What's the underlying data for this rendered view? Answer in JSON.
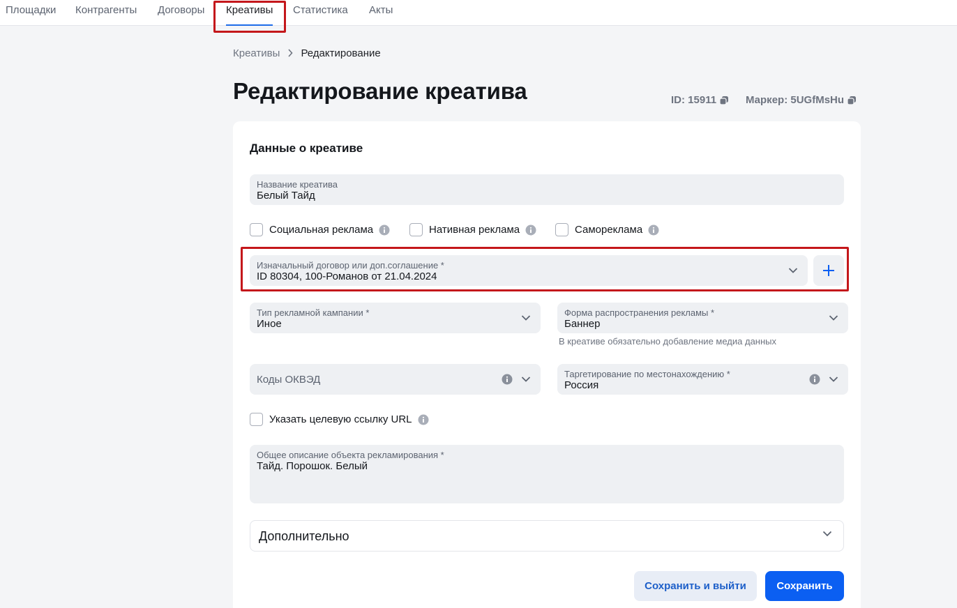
{
  "nav": {
    "tabs": [
      {
        "label": "Площадки"
      },
      {
        "label": "Контрагенты"
      },
      {
        "label": "Договоры"
      },
      {
        "label": "Креативы"
      },
      {
        "label": "Статистика"
      },
      {
        "label": "Акты"
      }
    ],
    "active": "Креативы"
  },
  "breadcrumb": {
    "parent": "Креативы",
    "current": "Редактирование"
  },
  "page": {
    "title": "Редактирование креатива",
    "id_label": "ID: 15911",
    "marker_label": "Маркер: 5UGfMsHu"
  },
  "form": {
    "section_title": "Данные о креативе",
    "name": {
      "label": "Название креатива",
      "value": "Белый Тайд"
    },
    "checkboxes": [
      {
        "label": "Социальная реклама",
        "checked": false
      },
      {
        "label": "Нативная реклама",
        "checked": false
      },
      {
        "label": "Самореклама",
        "checked": false
      }
    ],
    "contract": {
      "label": "Изначальный договор или доп.соглашение *",
      "value": "ID 80304, 100-Романов от 21.04.2024"
    },
    "campaign_type": {
      "label": "Тип рекламной кампании *",
      "value": "Иное"
    },
    "distribution_form": {
      "label": "Форма распространения рекламы *",
      "value": "Баннер",
      "hint": "В креативе обязательно добавление медиа данных"
    },
    "okved": {
      "placeholder": "Коды ОКВЭД"
    },
    "targeting": {
      "label": "Таргетирование по местонахождению *",
      "value": "Россия"
    },
    "target_url": {
      "label": "Указать целевую ссылку URL",
      "checked": false
    },
    "description": {
      "label": "Общее описание объекта рекламирования *",
      "value": "Тайд. Порошок. Белый"
    },
    "extra_label": "Дополнительно",
    "save_exit_label": "Сохранить и выйти",
    "save_label": "Сохранить"
  },
  "colors": {
    "accent": "#0b5ff2",
    "highlight": "#c4171b",
    "field_bg": "#eef0f3"
  }
}
